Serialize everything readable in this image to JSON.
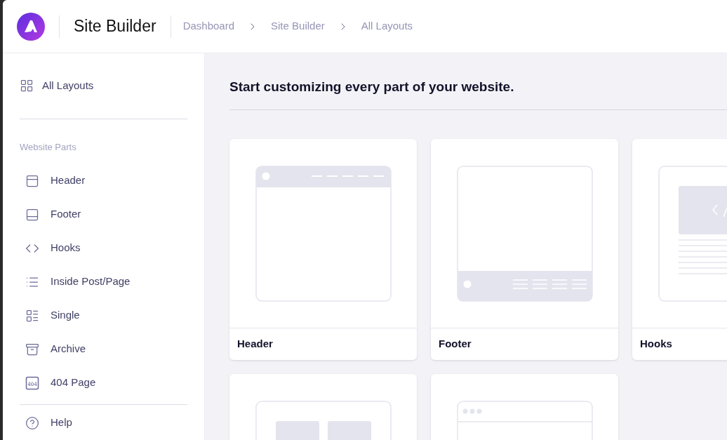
{
  "app": {
    "title": "Site Builder"
  },
  "breadcrumbs": [
    "Dashboard",
    "Site Builder",
    "All Layouts"
  ],
  "sidebar": {
    "top_item": {
      "label": "All Layouts",
      "kind": "grid"
    },
    "section_title": "Website Parts",
    "items": [
      {
        "label": "Header",
        "kind": "header"
      },
      {
        "label": "Footer",
        "kind": "footer"
      },
      {
        "label": "Hooks",
        "kind": "code"
      },
      {
        "label": "Inside Post/Page",
        "kind": "list"
      },
      {
        "label": "Single",
        "kind": "single"
      },
      {
        "label": "Archive",
        "kind": "archive"
      },
      {
        "label": "404 Page",
        "kind": "notfound",
        "icon_text": "404"
      }
    ],
    "bottom_item": {
      "label": "Help",
      "kind": "help"
    }
  },
  "main": {
    "heading": "Start customizing every part of your website.",
    "cards": [
      {
        "title": "Header",
        "kind": "header"
      },
      {
        "title": "Footer",
        "kind": "footer"
      },
      {
        "title": "Hooks",
        "kind": "hooks"
      },
      {
        "kind": "columns"
      },
      {
        "kind": "browser"
      }
    ]
  }
}
